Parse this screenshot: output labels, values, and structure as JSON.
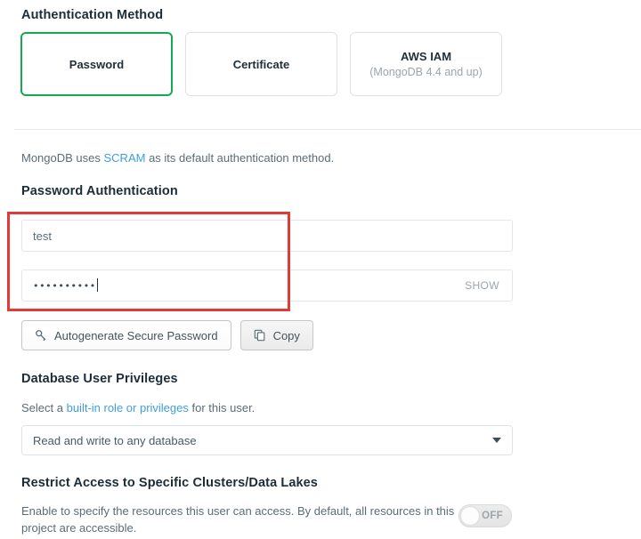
{
  "auth_method": {
    "heading": "Authentication Method",
    "options": [
      {
        "title": "Password",
        "subtitle": "",
        "selected": true
      },
      {
        "title": "Certificate",
        "subtitle": "",
        "selected": false
      },
      {
        "title": "AWS IAM",
        "subtitle": "(MongoDB 4.4 and up)",
        "selected": false
      }
    ],
    "selected_color": "#13aa52"
  },
  "scram_note": {
    "prefix": "MongoDB uses ",
    "link": "SCRAM",
    "suffix": " as its default authentication method."
  },
  "password_auth": {
    "heading": "Password Authentication",
    "username": {
      "value": "test",
      "placeholder": ""
    },
    "password": {
      "value": "••••••••••",
      "masked_char_count": 10,
      "show_label": "SHOW"
    },
    "autogenerate_label": "Autogenerate Secure Password",
    "autogenerate_icon": "key-icon",
    "copy_label": "Copy",
    "copy_icon": "copy-icon"
  },
  "annotation": {
    "color": "#e23b37"
  },
  "privileges": {
    "heading": "Database User Privileges",
    "desc_prefix": "Select a ",
    "desc_link": "built-in role or privileges",
    "desc_suffix": " for this user.",
    "selected_role": "Read and write to any database",
    "options": [
      "Read and write to any database"
    ]
  },
  "restrict_access": {
    "heading": "Restrict Access to Specific Clusters/Data Lakes",
    "description": "Enable to specify the resources this user can access. By default, all resources in this project are accessible.",
    "toggle_state": "OFF"
  },
  "colors": {
    "accent_green": "#13aa52",
    "link_blue": "#3d9fe0",
    "annotation_red": "#e23b37",
    "text_dark": "#1c2d38",
    "text_body": "#5c6c75"
  }
}
